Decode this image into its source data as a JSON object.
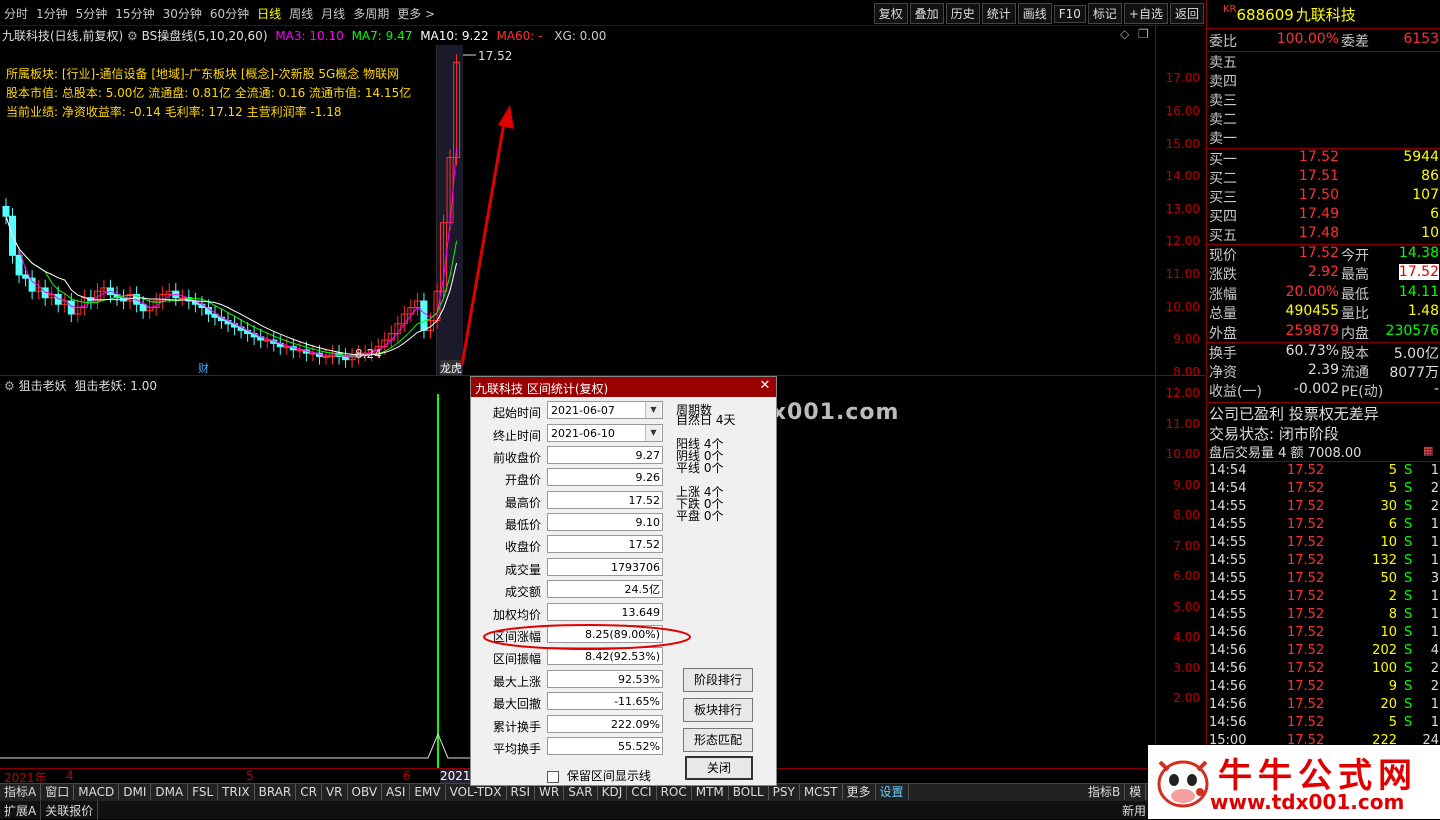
{
  "toolbar": {
    "periods": [
      "分时",
      "1分钟",
      "5分钟",
      "15分钟",
      "30分钟",
      "60分钟",
      "日线",
      "周线",
      "月线",
      "多周期",
      "更多 >"
    ],
    "active_period": "日线",
    "right_buttons": [
      "复权",
      "叠加",
      "历史",
      "统计",
      "画线",
      "F10",
      "标记",
      "+自选",
      "返回"
    ]
  },
  "chart": {
    "stock_title": "九联科技(日线,前复权)",
    "indicator_name": "BS操盘线(5,10,20,60)",
    "ma3": "MA3: 10.10",
    "ma7": "MA7: 9.47",
    "ma10": "MA10: 9.22",
    "ma60": "MA60: -",
    "xg": "XG: 0.00",
    "info_line1": "所属板块: [行业]-通信设备 [地域]-广东板块 [概念]-次新股 5G概念 物联网",
    "info_line2": "股本市值: 总股本: 5.00亿 流通盘: 0.81亿 全流通: 0.16 流通市值: 14.15亿",
    "info_line3": "当前业绩: 净资收益率: -0.14 毛利率: 17.12 主营利润率 -1.18",
    "high_label": "17.52",
    "low_label": "8.24",
    "price_ticks": [
      "17.00",
      "16.00",
      "15.00",
      "14.00",
      "13.00",
      "12.00",
      "11.00",
      "10.00",
      "9.00",
      "8.00"
    ],
    "marker_cai": "财",
    "marker_longhu": "龙虎"
  },
  "indicator_panel": {
    "title": "狙击老妖",
    "value": "狙击老妖: 1.00",
    "ticks": [
      "12.00",
      "11.00",
      "10.00",
      "9.00",
      "8.00",
      "7.00",
      "6.00",
      "5.00",
      "4.00",
      "3.00",
      "2.00"
    ],
    "dates": [
      "2021年",
      "4",
      "5",
      "6",
      "2021/"
    ]
  },
  "indicator_tabs": [
    "指标A",
    "窗口",
    "MACD",
    "DMI",
    "DMA",
    "FSL",
    "TRIX",
    "BRAR",
    "CR",
    "VR",
    "OBV",
    "ASI",
    "EMV",
    "VOL-TDX",
    "RSI",
    "WR",
    "SAR",
    "KDJ",
    "CCI",
    "ROC",
    "MTM",
    "BOLL",
    "PSY",
    "MCST",
    "更多",
    "设置"
  ],
  "indicator_tabs_right": [
    "指标B",
    "模"
  ],
  "bottom_bar": [
    "扩展A",
    "关联报价"
  ],
  "bottom_bar_right": [
    "新用"
  ],
  "quote": {
    "code_prefix": "KR",
    "code": "688609",
    "name": "九联科技",
    "weibi_label": "委比",
    "weibi": "100.00%",
    "weicha_label": "委差",
    "weicha": "6153",
    "asks": [
      {
        "label": "卖五",
        "price": "",
        "vol": ""
      },
      {
        "label": "卖四",
        "price": "",
        "vol": ""
      },
      {
        "label": "卖三",
        "price": "",
        "vol": ""
      },
      {
        "label": "卖二",
        "price": "",
        "vol": ""
      },
      {
        "label": "卖一",
        "price": "",
        "vol": ""
      }
    ],
    "bids": [
      {
        "label": "买一",
        "price": "17.52",
        "vol": "5944"
      },
      {
        "label": "买二",
        "price": "17.51",
        "vol": "86"
      },
      {
        "label": "买三",
        "price": "17.50",
        "vol": "107"
      },
      {
        "label": "买四",
        "price": "17.49",
        "vol": "6"
      },
      {
        "label": "买五",
        "price": "17.48",
        "vol": "10"
      }
    ],
    "stats": [
      {
        "l": "现价",
        "v": "17.52",
        "l2": "今开",
        "v2": "14.38"
      },
      {
        "l": "涨跌",
        "v": "2.92",
        "l2": "最高",
        "v2": "17.52"
      },
      {
        "l": "涨幅",
        "v": "20.00%",
        "l2": "最低",
        "v2": "14.11"
      },
      {
        "l": "总量",
        "v": "490455",
        "l2": "量比",
        "v2": "1.48"
      },
      {
        "l": "外盘",
        "v": "259879",
        "l2": "内盘",
        "v2": "230576"
      }
    ],
    "stats2": [
      {
        "l": "换手",
        "v": "60.73%",
        "l2": "股本",
        "v2": "5.00亿"
      },
      {
        "l": "净资",
        "v": "2.39",
        "l2": "流通",
        "v2": "8077万"
      },
      {
        "l": "收益(一)",
        "v": "-0.002",
        "l2": "PE(动)",
        "v2": "-"
      }
    ],
    "note1": "公司已盈利 投票权无差异",
    "note2": "交易状态: 闭市阶段",
    "note3": "盘后交易量 4 额 7008.00",
    "ticks": [
      {
        "t": "14:54",
        "p": "17.52",
        "q": "5",
        "s": "S",
        "n": "1"
      },
      {
        "t": "14:54",
        "p": "17.52",
        "q": "5",
        "s": "S",
        "n": "2"
      },
      {
        "t": "14:55",
        "p": "17.52",
        "q": "30",
        "s": "S",
        "n": "2"
      },
      {
        "t": "14:55",
        "p": "17.52",
        "q": "6",
        "s": "S",
        "n": "1"
      },
      {
        "t": "14:55",
        "p": "17.52",
        "q": "10",
        "s": "S",
        "n": "1"
      },
      {
        "t": "14:55",
        "p": "17.52",
        "q": "132",
        "s": "S",
        "n": "1"
      },
      {
        "t": "14:55",
        "p": "17.52",
        "q": "50",
        "s": "S",
        "n": "3"
      },
      {
        "t": "14:55",
        "p": "17.52",
        "q": "2",
        "s": "S",
        "n": "1"
      },
      {
        "t": "14:55",
        "p": "17.52",
        "q": "8",
        "s": "S",
        "n": "1"
      },
      {
        "t": "14:56",
        "p": "17.52",
        "q": "10",
        "s": "S",
        "n": "1"
      },
      {
        "t": "14:56",
        "p": "17.52",
        "q": "202",
        "s": "S",
        "n": "4"
      },
      {
        "t": "14:56",
        "p": "17.52",
        "q": "100",
        "s": "S",
        "n": "2"
      },
      {
        "t": "14:56",
        "p": "17.52",
        "q": "9",
        "s": "S",
        "n": "2"
      },
      {
        "t": "14:56",
        "p": "17.52",
        "q": "20",
        "s": "S",
        "n": "1"
      },
      {
        "t": "14:56",
        "p": "17.52",
        "q": "5",
        "s": "S",
        "n": "1"
      },
      {
        "t": "15:00",
        "p": "17.52",
        "q": "222",
        "s": "",
        "n": "24"
      }
    ]
  },
  "dialog": {
    "title": "九联科技 区间统计(复权)",
    "fields": [
      {
        "label": "起始时间",
        "value": "2021-06-07",
        "type": "date"
      },
      {
        "label": "终止时间",
        "value": "2021-06-10",
        "type": "date"
      },
      {
        "label": "前收盘价",
        "value": "9.27"
      },
      {
        "label": "开盘价",
        "value": "9.26"
      },
      {
        "label": "最高价",
        "value": "17.52"
      },
      {
        "label": "最低价",
        "value": "9.10"
      },
      {
        "label": "收盘价",
        "value": "17.52"
      },
      {
        "label": "成交量",
        "value": "1793706"
      },
      {
        "label": "成交额",
        "value": "24.5亿"
      },
      {
        "label": "加权均价",
        "value": "13.649"
      },
      {
        "label": "区间涨幅",
        "value": "8.25(89.00%)"
      },
      {
        "label": "区间振幅",
        "value": "8.42(92.53%)"
      },
      {
        "label": "最大上涨",
        "value": "92.53%"
      },
      {
        "label": "最大回撤",
        "value": "-11.65%"
      },
      {
        "label": "累计换手",
        "value": "222.09%"
      },
      {
        "label": "平均换手",
        "value": "55.52%"
      }
    ],
    "stat_zhouqi": "周期数",
    "stat_ziran": "自然日 4天",
    "yangxian": "阳线 4个",
    "yinxian": "阴线 0个",
    "pingxian": "平线 0个",
    "shangzhang": "上涨 4个",
    "xiadie": "下跌 0个",
    "pingpan": "平盘 0个",
    "btn_stage": "阶段排行",
    "btn_sector": "板块排行",
    "btn_pattern": "形态匹配",
    "btn_close": "关闭",
    "checkbox_label": "保留区间显示线"
  },
  "watermark": {
    "text1": "牛牛公式网 www.tdx001.com",
    "title2": "牛牛公式网",
    "url2": "www.tdx001.com"
  },
  "colors": {
    "up": "#ff3030",
    "down": "#54ffff",
    "axis": "#c00000",
    "ma3": "#ff00ff",
    "ma7": "#00ff00",
    "ma10": "#ffffff"
  }
}
